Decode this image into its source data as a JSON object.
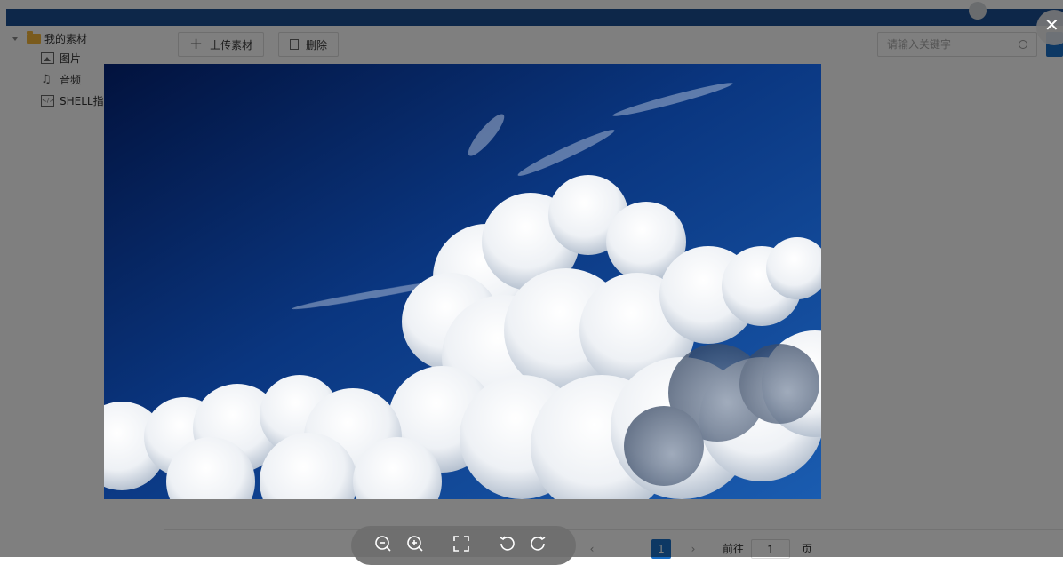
{
  "sidebar": {
    "root_label": "我的素材",
    "items": [
      {
        "label": "图片",
        "icon": "image-icon"
      },
      {
        "label": "音频",
        "icon": "music-icon"
      },
      {
        "label": "SHELL指令",
        "icon": "code-icon"
      }
    ]
  },
  "toolbar": {
    "upload_label": "上传素材",
    "delete_label": "删除"
  },
  "search": {
    "placeholder": "请输入关键字"
  },
  "pagination": {
    "current_page": "1",
    "goto_prefix": "前往",
    "goto_value": "1",
    "goto_suffix": "页"
  },
  "viewer": {
    "tools": [
      "zoom-out-icon",
      "zoom-in-icon",
      "fit-screen-icon",
      "rotate-left-icon",
      "rotate-right-icon"
    ],
    "close_icon": "close-icon"
  },
  "colors": {
    "topbar": "#1a4f93",
    "accent": "#1a70c9",
    "sky_deep": "#041a4f",
    "sky_mid": "#12489a",
    "cloud": "#f2f4f7"
  }
}
